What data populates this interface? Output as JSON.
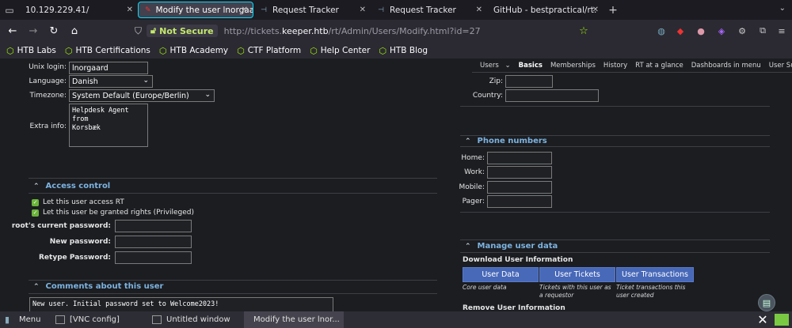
{
  "tabs": [
    {
      "title": "10.129.229.41/",
      "active": false
    },
    {
      "title": "Modify the user lnorgaard",
      "active": true
    },
    {
      "title": "Request Tracker",
      "active": false
    },
    {
      "title": "Request Tracker",
      "active": false
    },
    {
      "title": "GitHub - bestpractical/rt:",
      "active": false
    }
  ],
  "url": {
    "security": "Not Secure",
    "prefix": "http://tickets.",
    "domain": "keeper.htb",
    "path": "/rt/Admin/Users/Modify.html?id=27"
  },
  "bookmarks": [
    "HTB Labs",
    "HTB Certifications",
    "HTB Academy",
    "CTF Platform",
    "Help Center",
    "HTB Blog"
  ],
  "rt_nav": [
    "Users",
    "Basics",
    "Memberships",
    "History",
    "RT at a glance",
    "Dashboards in menu",
    "User Summary"
  ],
  "left": {
    "unix_login_label": "Unix login:",
    "unix_login": "lnorgaard",
    "language_label": "Language:",
    "language": "Danish",
    "timezone_label": "Timezone:",
    "timezone": "System Default (Europe/Berlin)",
    "extra_info_label": "Extra info:",
    "extra_info": "Helpdesk Agent from\nKorsbæk",
    "access_control": "Access control",
    "chk1": "Let this user access RT",
    "chk2": "Let this user be granted rights (Privileged)",
    "cur_pw": "root's current password:",
    "new_pw": "New password:",
    "re_pw": "Retype Password:",
    "comments": "Comments about this user",
    "comment_text": "New user. Initial password set to Welcome2023!"
  },
  "right": {
    "zip": "Zip:",
    "country": "Country:",
    "phone_section": "Phone numbers",
    "home": "Home:",
    "work": "Work:",
    "mobile": "Mobile:",
    "pager": "Pager:",
    "manage": "Manage user data",
    "download": "Download User Information",
    "btn_data": "User Data",
    "btn_tickets": "User Tickets",
    "btn_trans": "User Transactions",
    "note_data": "Core user data",
    "note_tickets": "Tickets with this user as a requestor",
    "note_trans": "Ticket transactions this user created",
    "remove": "Remove User Information"
  },
  "taskbar": [
    {
      "label": "Menu"
    },
    {
      "label": "[VNC config]"
    },
    {
      "label": "Untitled window"
    },
    {
      "label": "Modify the user lnor..."
    }
  ]
}
